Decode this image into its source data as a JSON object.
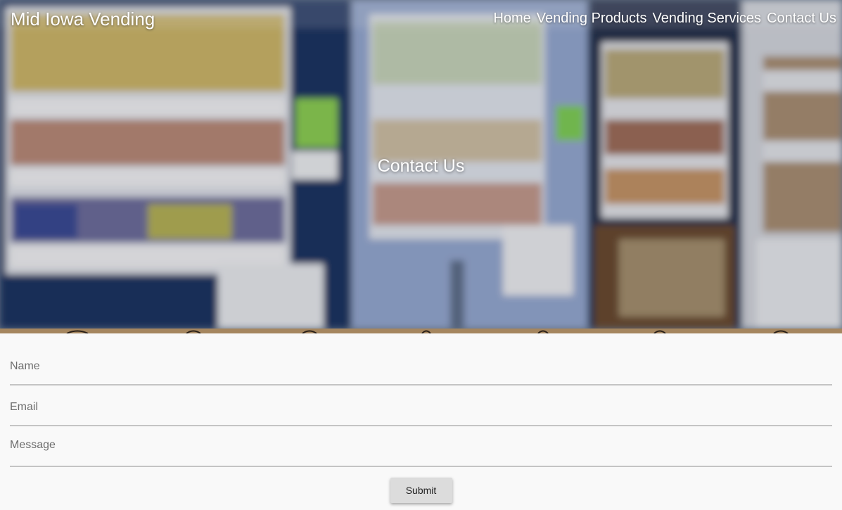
{
  "header": {
    "brand": "Mid Iowa Vending",
    "nav": [
      "Home",
      "Vending Products",
      "Vending Services",
      "Contact Us"
    ]
  },
  "hero": {
    "title": "Contact Us"
  },
  "form": {
    "name_placeholder": "Name",
    "email_placeholder": "Email",
    "message_placeholder": "Message",
    "submit_label": "Submit"
  },
  "colors": {
    "page_bg": "#f9f9f9",
    "underline": "#c4c4c4",
    "button_bg": "#dcdcdc",
    "hero_text": "#ffffff"
  }
}
